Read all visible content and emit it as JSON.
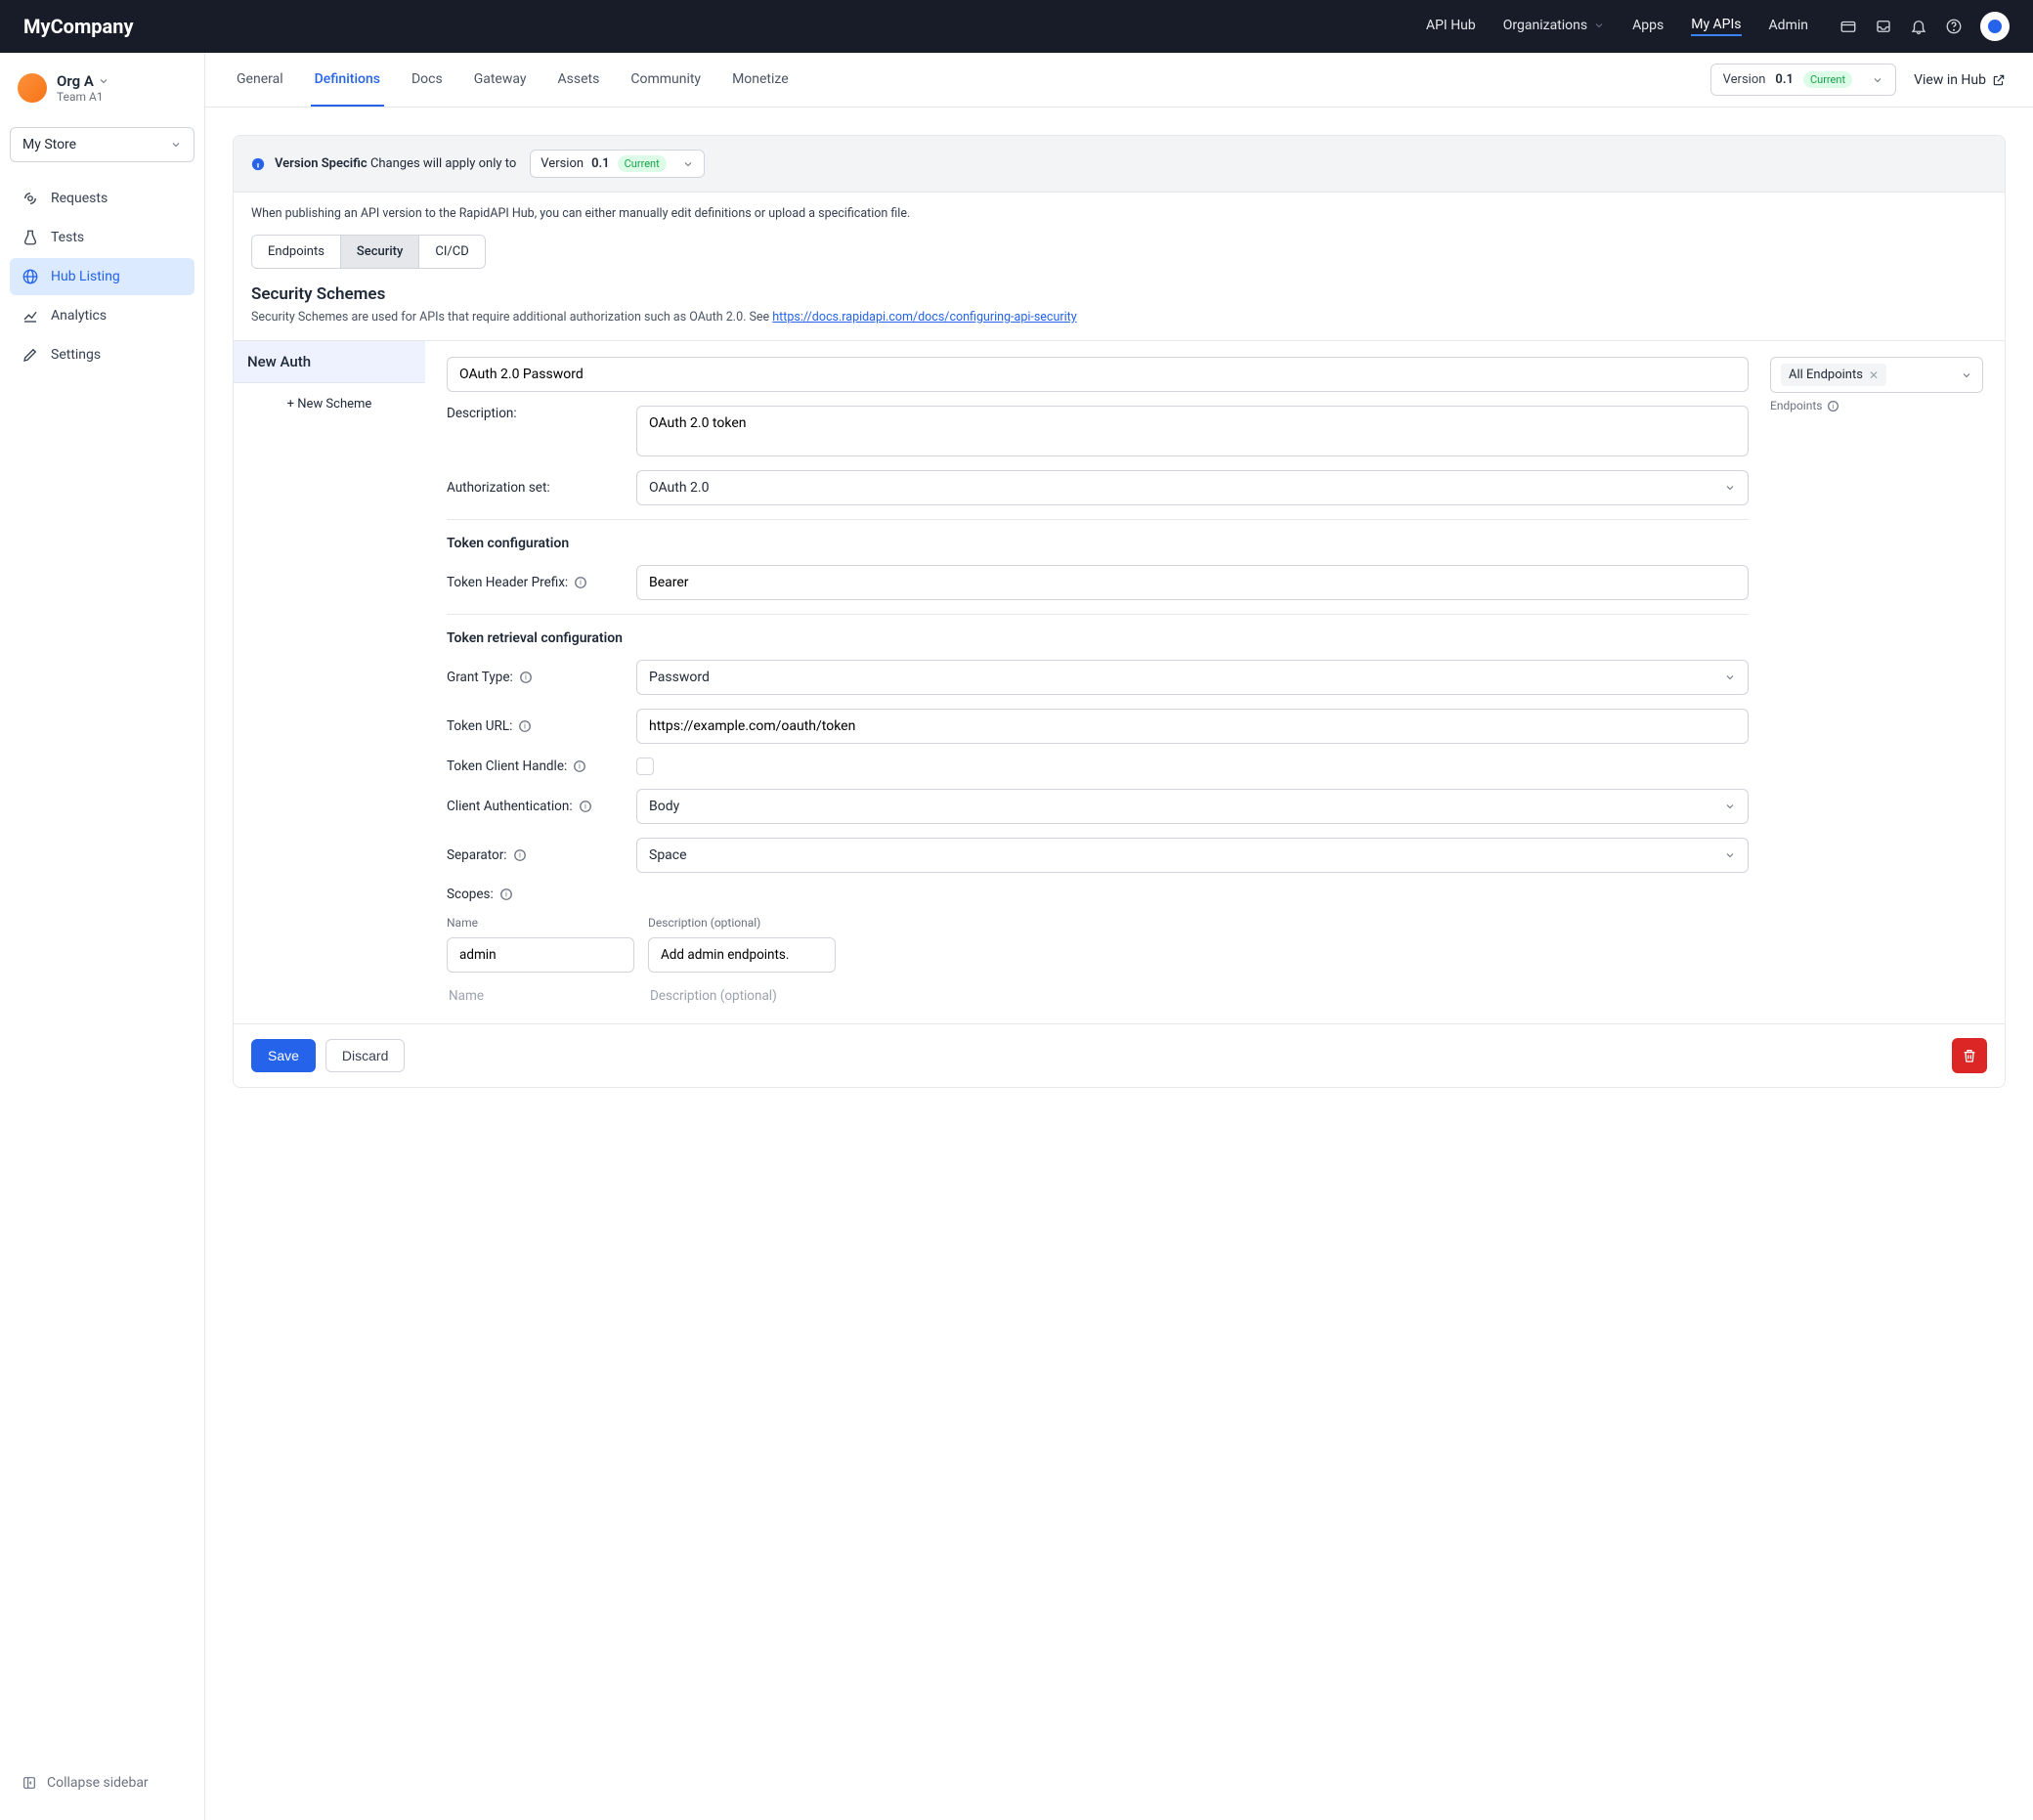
{
  "header": {
    "brand": "MyCompany",
    "nav": {
      "apihub": "API Hub",
      "organizations": "Organizations",
      "apps": "Apps",
      "myapis": "My APIs",
      "admin": "Admin"
    }
  },
  "sidebar": {
    "orgName": "Org A",
    "teamName": "Team A1",
    "storeLabel": "My Store",
    "items": {
      "requests": "Requests",
      "tests": "Tests",
      "hublisting": "Hub Listing",
      "analytics": "Analytics",
      "settings": "Settings"
    },
    "collapse": "Collapse sidebar"
  },
  "main": {
    "tabs": {
      "general": "General",
      "definitions": "Definitions",
      "docs": "Docs",
      "gateway": "Gateway",
      "assets": "Assets",
      "community": "Community",
      "monetize": "Monetize"
    },
    "version": {
      "word": "Version",
      "num": "0.1",
      "badge": "Current"
    },
    "viewHub": "View in Hub"
  },
  "panel": {
    "bannerStrong": "Version Specific",
    "bannerRest": "Changes will apply only to",
    "note": "When publishing an API version to the RapidAPI Hub, you can either manually edit definitions or upload a specification file.",
    "subtabs": {
      "endpoints": "Endpoints",
      "security": "Security",
      "cicd": "CI/CD"
    },
    "sectionTitle": "Security Schemes",
    "sectionSubPre": "Security Schemes are used for APIs that require additional authorization such as OAuth 2.0. See ",
    "sectionSubLink": "https://docs.rapidapi.com/docs/configuring-api-security",
    "schemeName": "New Auth",
    "newScheme": "+ New Scheme"
  },
  "form": {
    "nameValue": "OAuth 2.0 Password",
    "descLabel": "Description:",
    "descValue": "OAuth 2.0 token",
    "authSetLabel": "Authorization set:",
    "authSetValue": "OAuth 2.0",
    "tokenConfigHead": "Token configuration",
    "tokenHeaderLabel": "Token Header Prefix:",
    "tokenHeaderValue": "Bearer",
    "tokenRetrHead": "Token retrieval configuration",
    "grantTypeLabel": "Grant Type:",
    "grantTypeValue": "Password",
    "tokenUrlLabel": "Token URL:",
    "tokenUrlValue": "https://example.com/oauth/token",
    "tokenClientHandleLabel": "Token Client Handle:",
    "clientAuthLabel": "Client Authentication:",
    "clientAuthValue": "Body",
    "separatorLabel": "Separator:",
    "separatorValue": "Space",
    "scopesLabel": "Scopes:",
    "scopeHeadName": "Name",
    "scopeHeadDesc": "Description (optional)",
    "scope0Name": "admin",
    "scope0Desc": "Add admin endpoints.",
    "scopeEmptyName": "Name",
    "scopeEmptyDesc": "Description (optional)"
  },
  "side": {
    "chip": "All Endpoints",
    "endpointsLabel": "Endpoints"
  },
  "footer": {
    "save": "Save",
    "discard": "Discard"
  }
}
